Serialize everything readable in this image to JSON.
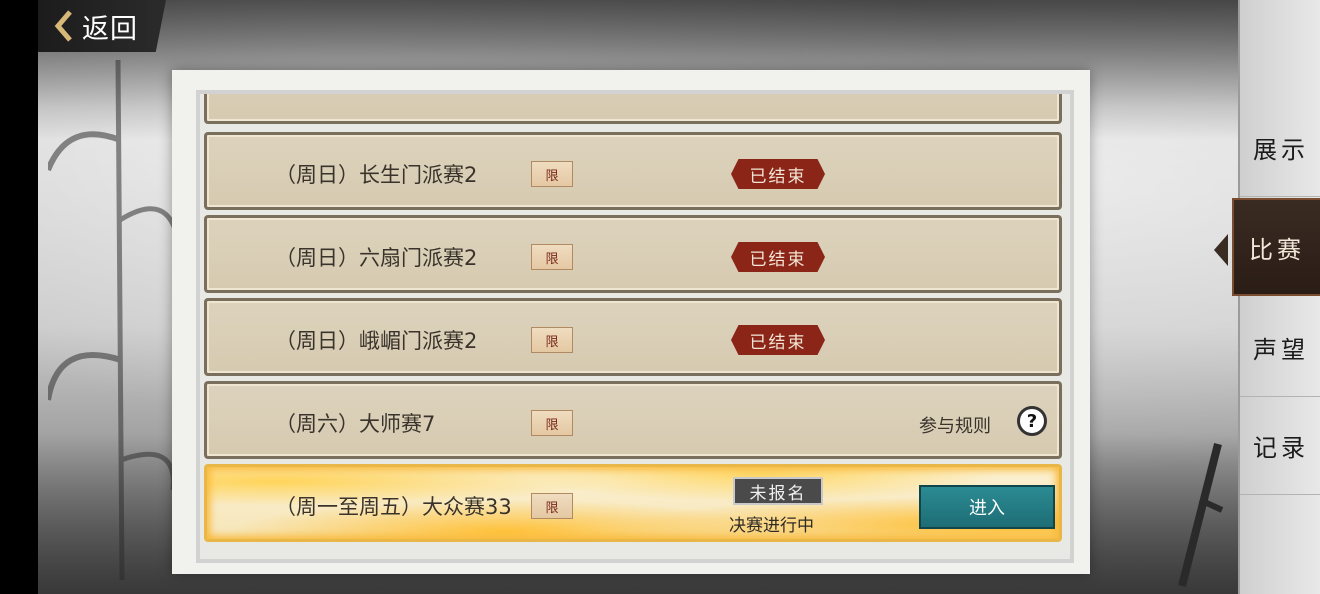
{
  "back": {
    "label": "返回",
    "icon": "chevron-left-icon"
  },
  "rows": [
    {
      "title": "（周日）长生门派赛2",
      "limit_badge": "限",
      "status": "已结束"
    },
    {
      "title": "（周日）六扇门派赛2",
      "limit_badge": "限",
      "status": "已结束"
    },
    {
      "title": "（周日）峨嵋门派赛2",
      "limit_badge": "限",
      "status": "已结束"
    },
    {
      "title": "（周六）大师赛7",
      "limit_badge": "限",
      "rules_label": "参与规则",
      "help_icon": "question-circle-icon"
    },
    {
      "title": "（周一至周五）大众赛33",
      "limit_badge": "限",
      "registration": "未报名",
      "phase": "决赛进行中",
      "action": "进入"
    }
  ],
  "tabs": [
    {
      "label": "展示"
    },
    {
      "label": "比赛",
      "active": true
    },
    {
      "label": "声望"
    },
    {
      "label": "记录"
    }
  ],
  "colors": {
    "ended_badge": "#8a2518",
    "enter_button": "#23808a",
    "row_bg": "#d8ccb2",
    "active_tab": "#2f2119"
  }
}
